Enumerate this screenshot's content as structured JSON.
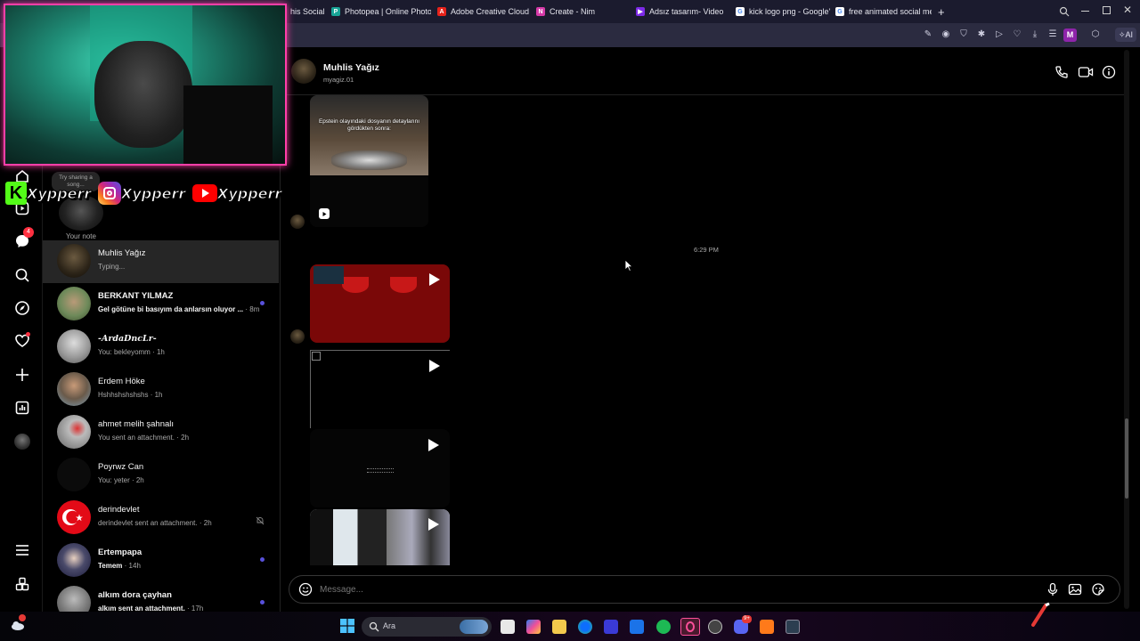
{
  "browser": {
    "tabs": [
      {
        "label": "his Social M",
        "fav": "",
        "favcolor": "#000000"
      },
      {
        "label": "Photopea | Online Photo E",
        "fav": "P",
        "favcolor": "#18a497"
      },
      {
        "label": "Adobe Creative Cloud | Pr",
        "fav": "A",
        "favcolor": "#e8231b"
      },
      {
        "label": "Create - Nim",
        "fav": "N",
        "favcolor": "#d63aa8"
      },
      {
        "label": "Adsız tasarım- Video",
        "fav": "▶",
        "favcolor": "#7d2ae8"
      },
      {
        "label": "kick logo png - Google'da",
        "fav": "G",
        "favcolor": "#ffffff"
      },
      {
        "label": "free animated social media",
        "fav": "G",
        "favcolor": "#ffffff"
      }
    ],
    "new_tab": "+",
    "profile_initial": "M",
    "ai_label": "AI"
  },
  "overlay": {
    "song_hint": "Try sharing a song...",
    "social_handles": [
      "Xypperr",
      "Xypperr",
      "Xypperr"
    ]
  },
  "notifications_badge": "4",
  "note": {
    "label": "Your note"
  },
  "conversations": [
    {
      "name": "Muhlis Yağız",
      "sub": "Typing...",
      "time": "",
      "unread": false,
      "active": true,
      "muted": false
    },
    {
      "name": "BERKANT YILMAZ",
      "sub": "Gel götüne bi basıyım da anlarsın oluyor ...",
      "time": "· 8m",
      "unread": true,
      "active": false,
      "muted": false
    },
    {
      "name": "-ArdaDncLr-",
      "sub": "You: bekleyomm",
      "time": "· 1h",
      "unread": false,
      "active": false,
      "muted": false
    },
    {
      "name": "Erdem Höke",
      "sub": "Hshhshshshshs",
      "time": "· 1h",
      "unread": false,
      "active": false,
      "muted": false
    },
    {
      "name": "ahmet melih şahnalı",
      "sub": "You sent an attachment.",
      "time": "· 2h",
      "unread": false,
      "active": false,
      "muted": false
    },
    {
      "name": "Poyrwz Can",
      "sub": "You: yeter",
      "time": "· 2h",
      "unread": false,
      "active": false,
      "muted": false
    },
    {
      "name": "derindevlet",
      "sub": "derindevlet sent an attachment.",
      "time": "· 2h",
      "unread": false,
      "active": false,
      "muted": true
    },
    {
      "name": "Ertempapa",
      "sub": "Temem",
      "time": "· 14h",
      "unread": true,
      "active": false,
      "muted": false
    },
    {
      "name": "alkım dora çayhan",
      "sub": "alkım sent an attachment.",
      "time": "· 17h",
      "unread": true,
      "active": false,
      "muted": false
    }
  ],
  "chat": {
    "contact_name": "Muhlis Yağız",
    "contact_username": "myagiz.01",
    "timestamp": "6:29 PM",
    "reel_caption": "Epstein olayındaki dosyanın detaylarını gördükten sonra:",
    "composer_placeholder": "Message..."
  },
  "taskbar": {
    "search_placeholder": "Ara",
    "discord_badge": "9+"
  }
}
